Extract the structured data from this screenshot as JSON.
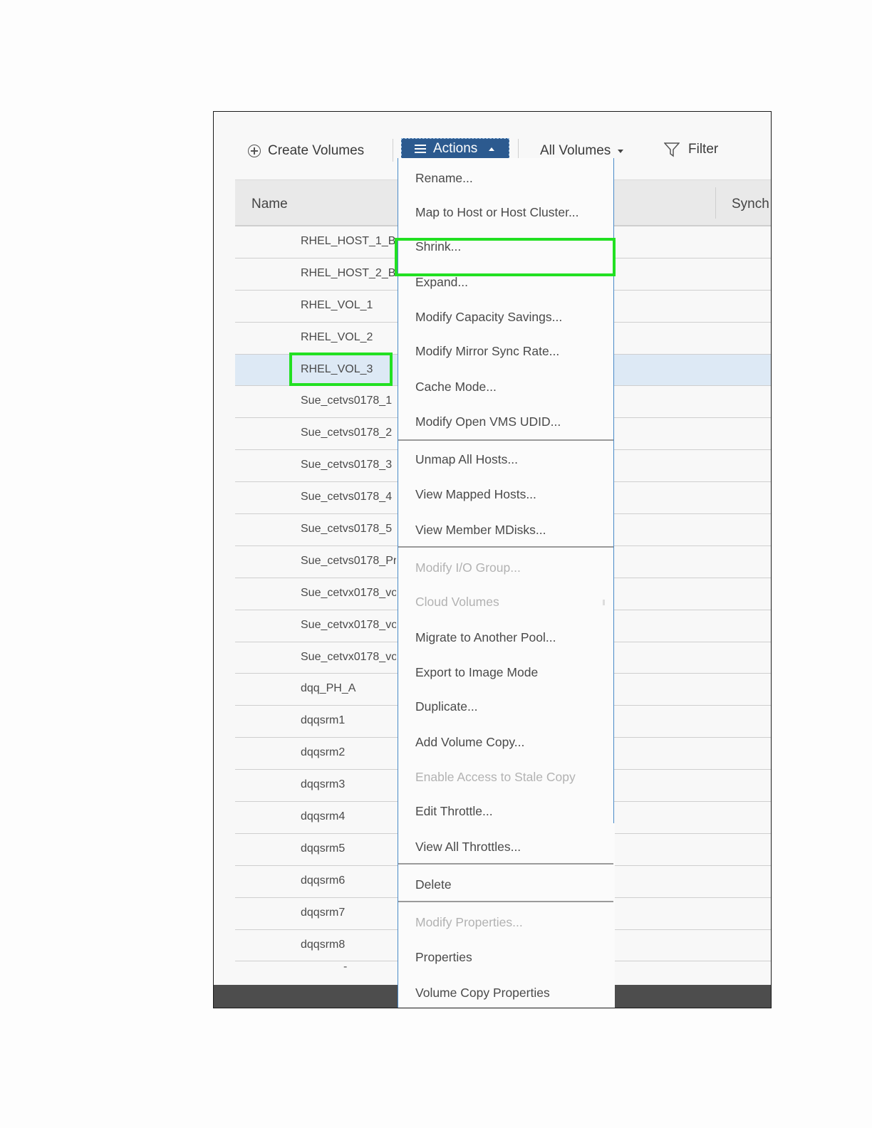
{
  "toolbar": {
    "create_label": "Create Volumes",
    "actions_label": "Actions",
    "all_volumes_label": "All Volumes",
    "filter_label": "Filter"
  },
  "table": {
    "columns": [
      "Name",
      "Synch"
    ],
    "rows": [
      "RHEL_HOST_1_B",
      "RHEL_HOST_2_B",
      "RHEL_VOL_1",
      "RHEL_VOL_2",
      "RHEL_VOL_3",
      "Sue_cetvs0178_1",
      "Sue_cetvs0178_2",
      "Sue_cetvs0178_3",
      "Sue_cetvs0178_4",
      "Sue_cetvs0178_5",
      "Sue_cetvs0178_Pr",
      "Sue_cetvx0178_vo",
      "Sue_cetvx0178_vo",
      "Sue_cetvx0178_vo",
      "dqq_PH_A",
      "dqqsrm1",
      "dqqsrm2",
      "dqqsrm3",
      "dqqsrm4",
      "dqqsrm5",
      "dqqsrm6",
      "dqqsrm7",
      "dqqsrm8"
    ],
    "selected_row": "RHEL_VOL_3",
    "trailing": "-"
  },
  "menu": {
    "items": [
      {
        "label": "Rename...",
        "enabled": true
      },
      {
        "label": "Map to Host or Host Cluster...",
        "enabled": true
      },
      {
        "label": "Shrink...",
        "enabled": true
      },
      {
        "label": "Expand...",
        "enabled": true
      },
      {
        "label": "Modify Capacity Savings...",
        "enabled": true
      },
      {
        "label": "Modify Mirror Sync Rate...",
        "enabled": true
      },
      {
        "label": "Cache Mode...",
        "enabled": true
      },
      {
        "label": "Modify Open VMS UDID...",
        "enabled": true
      },
      {
        "label": "Unmap All Hosts...",
        "enabled": true
      },
      {
        "label": "View Mapped Hosts...",
        "enabled": true
      },
      {
        "label": "View Member MDisks...",
        "enabled": true
      },
      {
        "label": "Modify I/O Group...",
        "enabled": false
      },
      {
        "label": "Cloud Volumes",
        "enabled": false
      },
      {
        "label": "Migrate to Another Pool...",
        "enabled": true
      },
      {
        "label": "Export to Image Mode",
        "enabled": true
      },
      {
        "label": "Duplicate...",
        "enabled": true
      },
      {
        "label": "Add Volume Copy...",
        "enabled": true
      },
      {
        "label": "Enable Access to Stale Copy",
        "enabled": false
      },
      {
        "label": "Edit Throttle...",
        "enabled": true
      },
      {
        "label": "View All Throttles...",
        "enabled": true
      },
      {
        "label": "Delete",
        "enabled": true
      },
      {
        "label": "Modify Properties...",
        "enabled": false
      },
      {
        "label": "Properties",
        "enabled": true
      },
      {
        "label": "Volume Copy Properties",
        "enabled": true
      }
    ]
  },
  "colors": {
    "actions_button": "#2c5a8f",
    "highlight": "#22e022",
    "selected_row": "#dde9f5",
    "menu_border": "#4a8ac8"
  }
}
